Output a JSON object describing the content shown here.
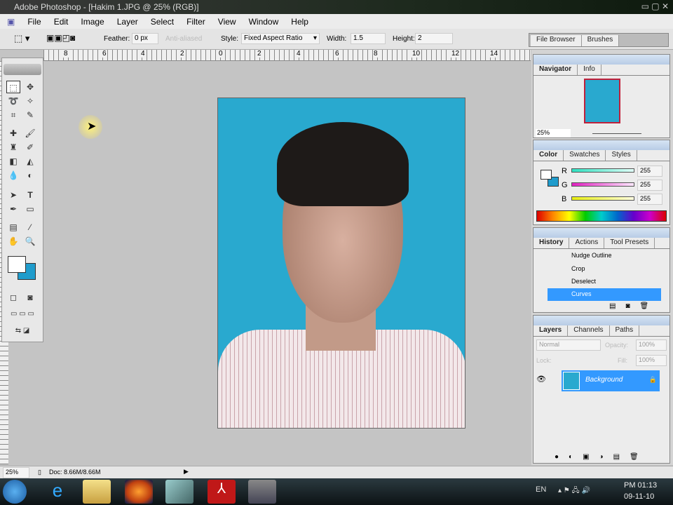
{
  "window": {
    "title": "Adobe Photoshop - [Hakim 1.JPG @ 25% (RGB)]"
  },
  "menu": [
    "File",
    "Edit",
    "Image",
    "Layer",
    "Select",
    "Filter",
    "View",
    "Window",
    "Help"
  ],
  "options": {
    "feather_label": "Feather:",
    "feather_value": "0 px",
    "anti_aliased": "Anti-aliased",
    "style_label": "Style:",
    "style_value": "Fixed Aspect Ratio",
    "width_label": "Width:",
    "width_value": "1.5",
    "height_label": "Height:",
    "height_value": "2"
  },
  "palette_well": [
    "File Browser",
    "Brushes"
  ],
  "ruler": {
    "h_ticks": [
      "8",
      "6",
      "4",
      "2",
      "0",
      "2",
      "4",
      "6",
      "8",
      "10",
      "12",
      "14"
    ]
  },
  "navigator": {
    "tabs": [
      "Navigator",
      "Info"
    ],
    "zoom": "25%"
  },
  "color": {
    "tabs": [
      "Color",
      "Swatches",
      "Styles"
    ],
    "channels": [
      {
        "label": "R",
        "value": "255"
      },
      {
        "label": "G",
        "value": "255"
      },
      {
        "label": "B",
        "value": "255"
      }
    ],
    "foreground": "#ffffff",
    "background": "#1f9ccc"
  },
  "history": {
    "tabs": [
      "History",
      "Actions",
      "Tool Presets"
    ],
    "items": [
      "Nudge Outline",
      "Crop",
      "Deselect",
      "Curves"
    ],
    "selected": "Curves"
  },
  "layers": {
    "tabs": [
      "Layers",
      "Channels",
      "Paths"
    ],
    "blend_mode": "Normal",
    "opacity_label": "Opacity:",
    "opacity": "100%",
    "lock_label": "Lock:",
    "fill_label": "Fill:",
    "fill": "100%",
    "layer_name": "Background"
  },
  "status": {
    "zoom": "25%",
    "doc": "Doc: 8.66M/8.66M"
  },
  "taskbar": {
    "lang": "EN",
    "time": "PM 01:13",
    "date": "09-11-10"
  },
  "colors": {
    "accent": "#3399ff",
    "photo_bg": "#29a9cf"
  }
}
